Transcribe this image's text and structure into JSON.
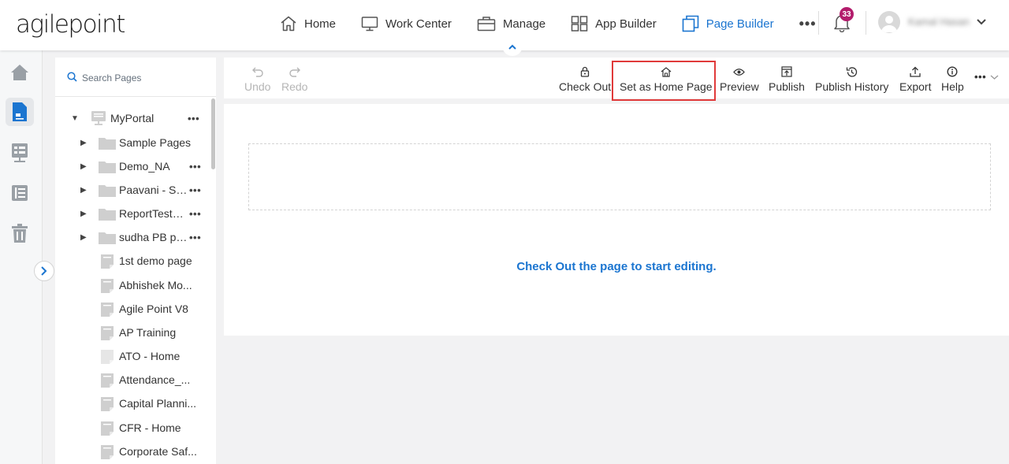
{
  "brand": {
    "logo_text": "agilepoint"
  },
  "nav": {
    "items": [
      {
        "label": "Home",
        "icon": "home-icon"
      },
      {
        "label": "Work Center",
        "icon": "monitor-icon"
      },
      {
        "label": "Manage",
        "icon": "briefcase-icon"
      },
      {
        "label": "App Builder",
        "icon": "grid-icon"
      },
      {
        "label": "Page Builder",
        "icon": "pages-icon",
        "active": true
      }
    ],
    "more_label": "•••"
  },
  "notifications": {
    "count": "33"
  },
  "user": {
    "name": "Kamal Hasan"
  },
  "left_rail": {
    "items": [
      "home-icon",
      "page-icon",
      "form-icon",
      "list-icon",
      "trash-icon"
    ],
    "active_index": 1
  },
  "tree": {
    "search_placeholder": "Search Pages",
    "root": {
      "label": "MyPortal"
    },
    "folders": [
      {
        "label": "Sample Pages",
        "more": false
      },
      {
        "label": "Demo_NA",
        "more": true
      },
      {
        "label": "Paavani - SMS",
        "more": true
      },
      {
        "label": "ReportTestBi...",
        "more": true
      },
      {
        "label": "sudha PB pra...",
        "more": true
      }
    ],
    "pages": [
      {
        "label": "1st demo page",
        "faded": false
      },
      {
        "label": "Abhishek Mo...",
        "faded": false
      },
      {
        "label": "Agile Point V8",
        "faded": false
      },
      {
        "label": "AP Training",
        "faded": false
      },
      {
        "label": "ATO - Home",
        "faded": true
      },
      {
        "label": "Attendance_...",
        "faded": false
      },
      {
        "label": "Capital Planni...",
        "faded": false
      },
      {
        "label": "CFR - Home",
        "faded": false
      },
      {
        "label": "Corporate Saf...",
        "faded": false
      }
    ],
    "more_label": "•••"
  },
  "toolbar": {
    "undo": "Undo",
    "redo": "Redo",
    "check_out": "Check Out",
    "set_home": "Set as Home Page",
    "preview": "Preview",
    "publish": "Publish",
    "publish_history": "Publish History",
    "export": "Export",
    "help": "Help",
    "more": "•••"
  },
  "canvas": {
    "hint": "Check Out the page to start editing."
  },
  "colors": {
    "accent": "#1b75d0",
    "badge": "#b31c6c",
    "highlight": "#e03a3a"
  }
}
